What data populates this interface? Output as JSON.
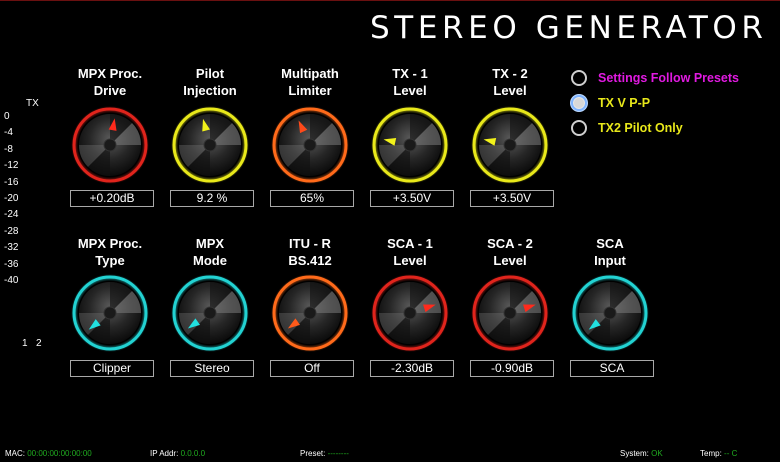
{
  "title": "STEREO GENERATOR",
  "meter": {
    "header": "TX",
    "scale": [
      "0",
      "-4",
      "-8",
      "-12",
      "-16",
      "-20",
      "-24",
      "-28",
      "-32",
      "-36",
      "-40"
    ],
    "channels": [
      "1",
      "2"
    ]
  },
  "knobs": [
    {
      "label1": "MPX  Proc.",
      "label2": "Drive",
      "value": "+0.20dB",
      "ring": "#e0241c",
      "pointer": "#ff2a1c",
      "angle": 10
    },
    {
      "label1": "Pilot",
      "label2": "Injection",
      "value": "9.2 %",
      "ring": "#e8e81a",
      "pointer": "#f2f21a",
      "angle": -15
    },
    {
      "label1": "Multipath",
      "label2": "Limiter",
      "value": "65%",
      "ring": "#ff6a1a",
      "pointer": "#ff4a1a",
      "angle": -25
    },
    {
      "label1": "TX - 1",
      "label2": "Level",
      "value": "+3.50V",
      "ring": "#e8e81a",
      "pointer": "#f2f21a",
      "angle": -78
    },
    {
      "label1": "TX - 2",
      "label2": "Level",
      "value": "+3.50V",
      "ring": "#e8e81a",
      "pointer": "#f2f21a",
      "angle": -78
    },
    {
      "label1": "MPX Proc.",
      "label2": "Type",
      "value": "Clipper",
      "ring": "#22d2d2",
      "pointer": "#22e0e0",
      "angle": -128
    },
    {
      "label1": "MPX",
      "label2": "Mode",
      "value": "Stereo",
      "ring": "#22d2d2",
      "pointer": "#22e0e0",
      "angle": -125
    },
    {
      "label1": "ITU - R",
      "label2": "BS.412",
      "value": "Off",
      "ring": "#ff6a1a",
      "pointer": "#ff5a1a",
      "angle": -125
    },
    {
      "label1": "SCA - 1",
      "label2": "Level",
      "value": "-2.30dB",
      "ring": "#e0241c",
      "pointer": "#ff2a1c",
      "angle": 72
    },
    {
      "label1": "SCA - 2",
      "label2": "Level",
      "value": "-0.90dB",
      "ring": "#e0241c",
      "pointer": "#ff2a1c",
      "angle": 72
    },
    {
      "label1": "SCA",
      "label2": "Input",
      "value": "SCA",
      "ring": "#22d2d2",
      "pointer": "#22e0e0",
      "angle": -128
    }
  ],
  "options": [
    {
      "label": "Settings Follow Presets",
      "color": "#e01ae0",
      "selected": false
    },
    {
      "label": "TX V P-P",
      "color": "#e8e81a",
      "selected": true
    },
    {
      "label": "TX2 Pilot Only",
      "color": "#e8e81a",
      "selected": false
    }
  ],
  "status": {
    "mac_label": "MAC:",
    "mac_value": "00:00:00:00:00:00",
    "ip_label": "IP Addr:",
    "ip_value": "0.0.0.0",
    "preset_label": "Preset:",
    "preset_value": "--------",
    "system_label": "System:",
    "system_value": "OK",
    "temp_label": "Temp:",
    "temp_value": "-- C"
  }
}
